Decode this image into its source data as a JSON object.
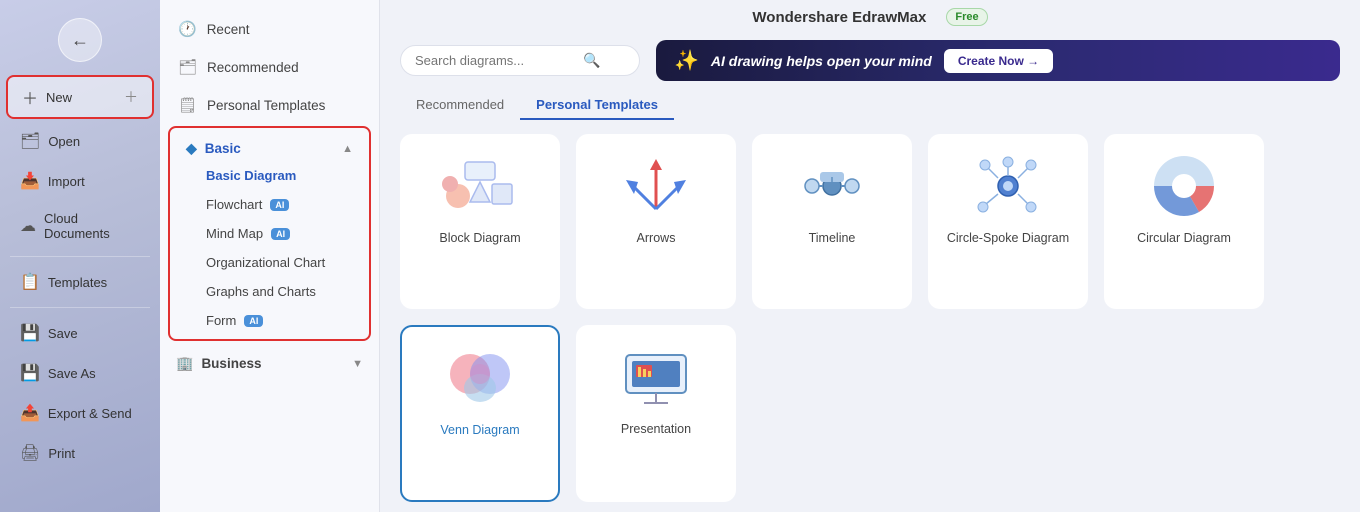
{
  "app": {
    "title": "Wondershare EdrawMax",
    "free_badge": "Free"
  },
  "sidebar": {
    "items": [
      {
        "id": "new",
        "label": "New",
        "icon": "+"
      },
      {
        "id": "open",
        "label": "Open",
        "icon": "📂"
      },
      {
        "id": "import",
        "label": "Import",
        "icon": "📥"
      },
      {
        "id": "cloud",
        "label": "Cloud Documents",
        "icon": "☁"
      },
      {
        "id": "templates",
        "label": "Templates",
        "icon": "📋"
      },
      {
        "id": "save",
        "label": "Save",
        "icon": "💾"
      },
      {
        "id": "saveas",
        "label": "Save As",
        "icon": "💾"
      },
      {
        "id": "export",
        "label": "Export & Send",
        "icon": "📤"
      },
      {
        "id": "print",
        "label": "Print",
        "icon": "🖨"
      }
    ]
  },
  "middle": {
    "nav": [
      {
        "id": "recent",
        "label": "Recent",
        "icon": "🕐"
      },
      {
        "id": "recommended",
        "label": "Recommended",
        "icon": "🗂"
      },
      {
        "id": "personal",
        "label": "Personal Templates",
        "icon": "🗒"
      }
    ],
    "basic_section": {
      "title": "Basic",
      "items": [
        {
          "id": "basic-diagram",
          "label": "Basic Diagram",
          "active": true
        },
        {
          "id": "flowchart",
          "label": "Flowchart",
          "badge": "AI"
        },
        {
          "id": "mind-map",
          "label": "Mind Map",
          "badge": "AI"
        },
        {
          "id": "org-chart",
          "label": "Organizational Chart",
          "badge": null
        },
        {
          "id": "graphs-charts",
          "label": "Graphs and Charts",
          "badge": null
        },
        {
          "id": "form",
          "label": "Form",
          "badge": "AI"
        }
      ]
    },
    "business_section": {
      "title": "Business",
      "collapsed": true
    }
  },
  "search": {
    "placeholder": "Search diagrams..."
  },
  "ai_banner": {
    "text": "AI drawing helps open your mind",
    "btn_label": "Create Now →"
  },
  "tabs": [
    {
      "id": "recommended",
      "label": "Recommended",
      "active": false
    },
    {
      "id": "personal",
      "label": "Personal Templates",
      "active": true
    }
  ],
  "diagrams": [
    {
      "id": "block",
      "label": "Block Diagram",
      "selected": false
    },
    {
      "id": "arrows",
      "label": "Arrows",
      "selected": false
    },
    {
      "id": "timeline",
      "label": "Timeline",
      "selected": false
    },
    {
      "id": "circle-spoke",
      "label": "Circle-Spoke Diagram",
      "selected": false
    },
    {
      "id": "circular",
      "label": "Circular Diagram",
      "selected": false
    },
    {
      "id": "venn",
      "label": "Venn Diagram",
      "selected": true
    },
    {
      "id": "presentation",
      "label": "Presentation",
      "selected": false
    }
  ]
}
